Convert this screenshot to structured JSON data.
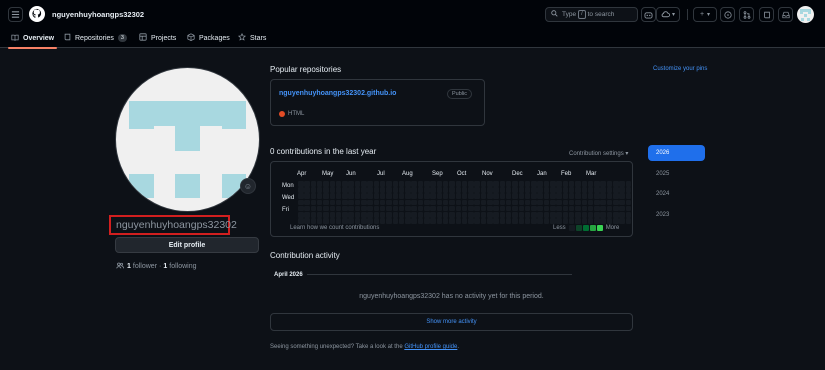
{
  "header": {
    "username": "nguyenhuyhoangps32302",
    "search_placeholder_before": "Type",
    "search_key": "/",
    "search_placeholder_after": "to search"
  },
  "tabs": [
    {
      "label": "Overview",
      "icon": "book-open-icon",
      "active": true
    },
    {
      "label": "Repositories",
      "icon": "repo-icon",
      "count": "3"
    },
    {
      "label": "Projects",
      "icon": "table-icon"
    },
    {
      "label": "Packages",
      "icon": "package-icon"
    },
    {
      "label": "Stars",
      "icon": "star-icon"
    }
  ],
  "profile": {
    "name": "nguyenhuyhoangps32302",
    "edit_label": "Edit profile",
    "followers": "1",
    "followers_label": "follower",
    "separator": "·",
    "following": "1",
    "following_label": "following"
  },
  "popular": {
    "title": "Popular repositories",
    "customize_label": "Customize your pins",
    "repos": [
      {
        "name": "nguyenhuyhoangps32302.github.io",
        "visibility": "Public",
        "language": "HTML",
        "language_color": "#e34c26"
      }
    ]
  },
  "contributions": {
    "title": "0 contributions in the last year",
    "settings_label": "Contribution settings",
    "months": [
      "Apr",
      "May",
      "Jun",
      "Jul",
      "Aug",
      "Sep",
      "Oct",
      "Nov",
      "Dec",
      "Jan",
      "Feb",
      "Mar"
    ],
    "days": [
      "Mon",
      "Wed",
      "Fri"
    ],
    "learn_label": "Learn how we count contributions",
    "less_label": "Less",
    "more_label": "More",
    "legend_colors": [
      "#161b22",
      "#0e4429",
      "#006d32",
      "#26a641",
      "#39d353"
    ]
  },
  "years": [
    "2026",
    "2025",
    "2024",
    "2023"
  ],
  "activity": {
    "title": "Contribution activity",
    "month": "April 2026",
    "empty_message": "nguyenhuyhoangps32302 has no activity yet for this period.",
    "show_more_label": "Show more activity",
    "unexpected_text": "Seeing something unexpected? Take a look at the",
    "guide_link": "GitHub profile guide",
    "guide_suffix": "."
  },
  "colors": {
    "background": "#0d1117",
    "header_bg": "#010409",
    "accent": "#4493f8",
    "tab_underline": "#f78166",
    "highlight_box": "#d21f1f"
  }
}
